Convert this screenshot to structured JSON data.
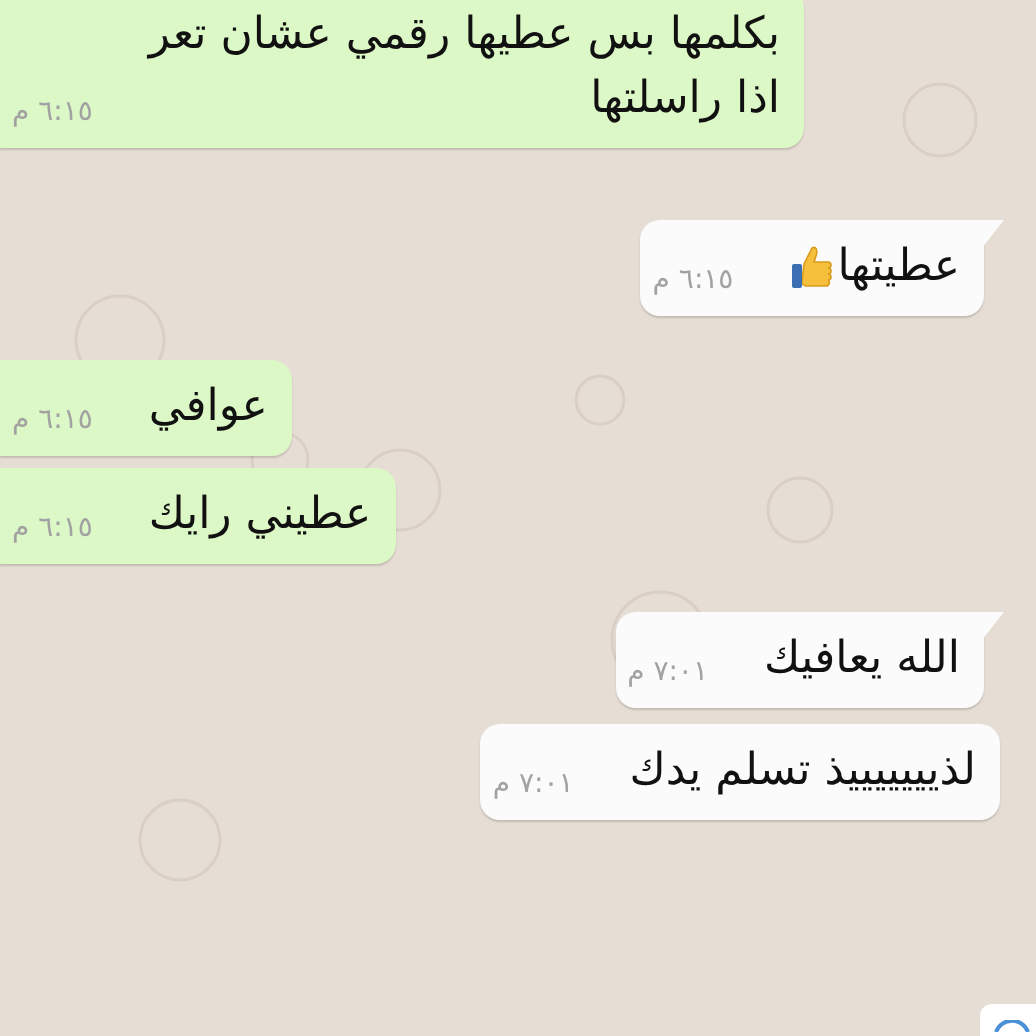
{
  "messages": [
    {
      "kind": "sent",
      "lines": [
        "بكلمها بس عطيها رقمي عشان تعر",
        "اذا راسلتها"
      ],
      "time": "٦:١٥ م",
      "tail": false
    },
    {
      "kind": "received",
      "lines": [
        "عطيتها"
      ],
      "thumbs_up": true,
      "time": "٦:١٥ م",
      "tail": true
    },
    {
      "kind": "sent",
      "lines": [
        "عوافي"
      ],
      "time": "٦:١٥ م",
      "tail": false
    },
    {
      "kind": "sent",
      "lines": [
        "عطيني رايك"
      ],
      "time": "٦:١٥ م",
      "tail": false
    },
    {
      "kind": "received",
      "lines": [
        "الله يعافيك"
      ],
      "time": "٧:٠١ م",
      "tail": true
    },
    {
      "kind": "received",
      "lines": [
        "لذيييييييذ تسلم يدك"
      ],
      "time": "٧:٠١ م",
      "tail": false
    }
  ]
}
